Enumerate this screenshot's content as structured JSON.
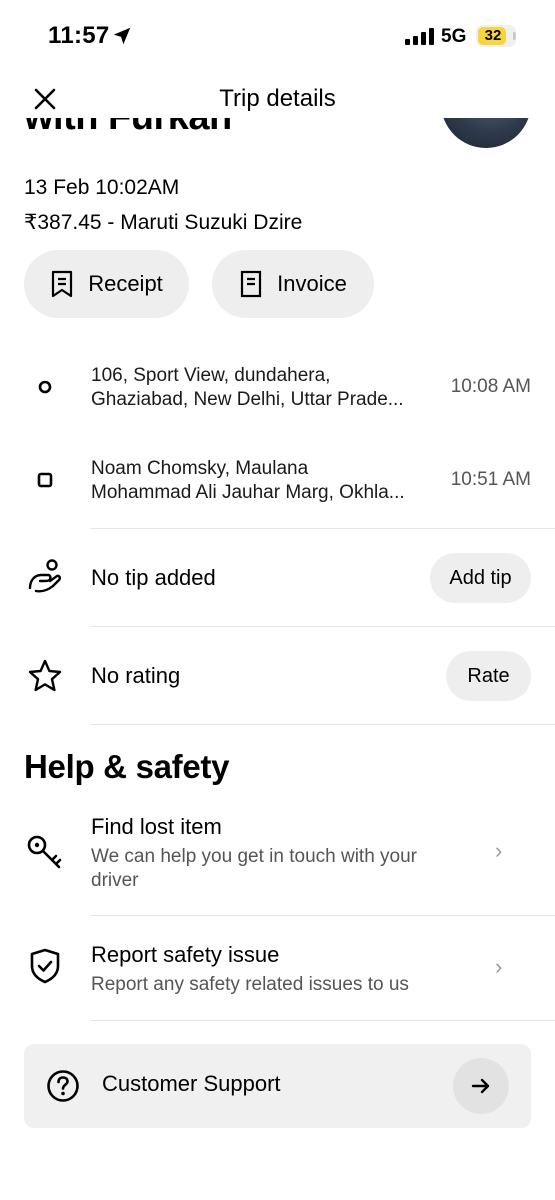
{
  "status_bar": {
    "time": "11:57",
    "network": "5G",
    "battery": "32",
    "battery_color": "#f7d63d"
  },
  "header": {
    "title": "Trip details",
    "close_icon": "close-icon"
  },
  "trip": {
    "heading": "with Furkan",
    "date": "13 Feb 10:02AM",
    "fare": "₹387.45 - Maruti Suzuki Dzire",
    "receipt_label": "Receipt",
    "invoice_label": "Invoice"
  },
  "route": {
    "pickup": {
      "line1": "106, Sport View, dundahera,",
      "line2": "Ghaziabad, New Delhi, Uttar Prade...",
      "time": "10:08 AM",
      "icon": "pickup-circle-icon"
    },
    "dropoff": {
      "line1": "Noam Chomsky, Maulana",
      "line2": "Mohammad Ali Jauhar Marg, Okhla...",
      "time": "10:51 AM",
      "icon": "dropoff-square-icon"
    }
  },
  "tip": {
    "label": "No tip added",
    "button": "Add tip",
    "icon": "tip-hand-icon"
  },
  "rating": {
    "label": "No rating",
    "button": "Rate",
    "icon": "star-icon"
  },
  "help": {
    "title": "Help & safety",
    "items": [
      {
        "title": "Find lost item",
        "subtitle": "We can help you get in touch with your driver",
        "icon": "key-icon"
      },
      {
        "title": "Report safety issue",
        "subtitle": "Report any safety related issues to us",
        "icon": "shield-check-icon"
      }
    ],
    "chevron": "›"
  },
  "support": {
    "label": "Customer Support",
    "icon": "question-circle-icon",
    "arrow_icon": "arrow-right-icon"
  }
}
